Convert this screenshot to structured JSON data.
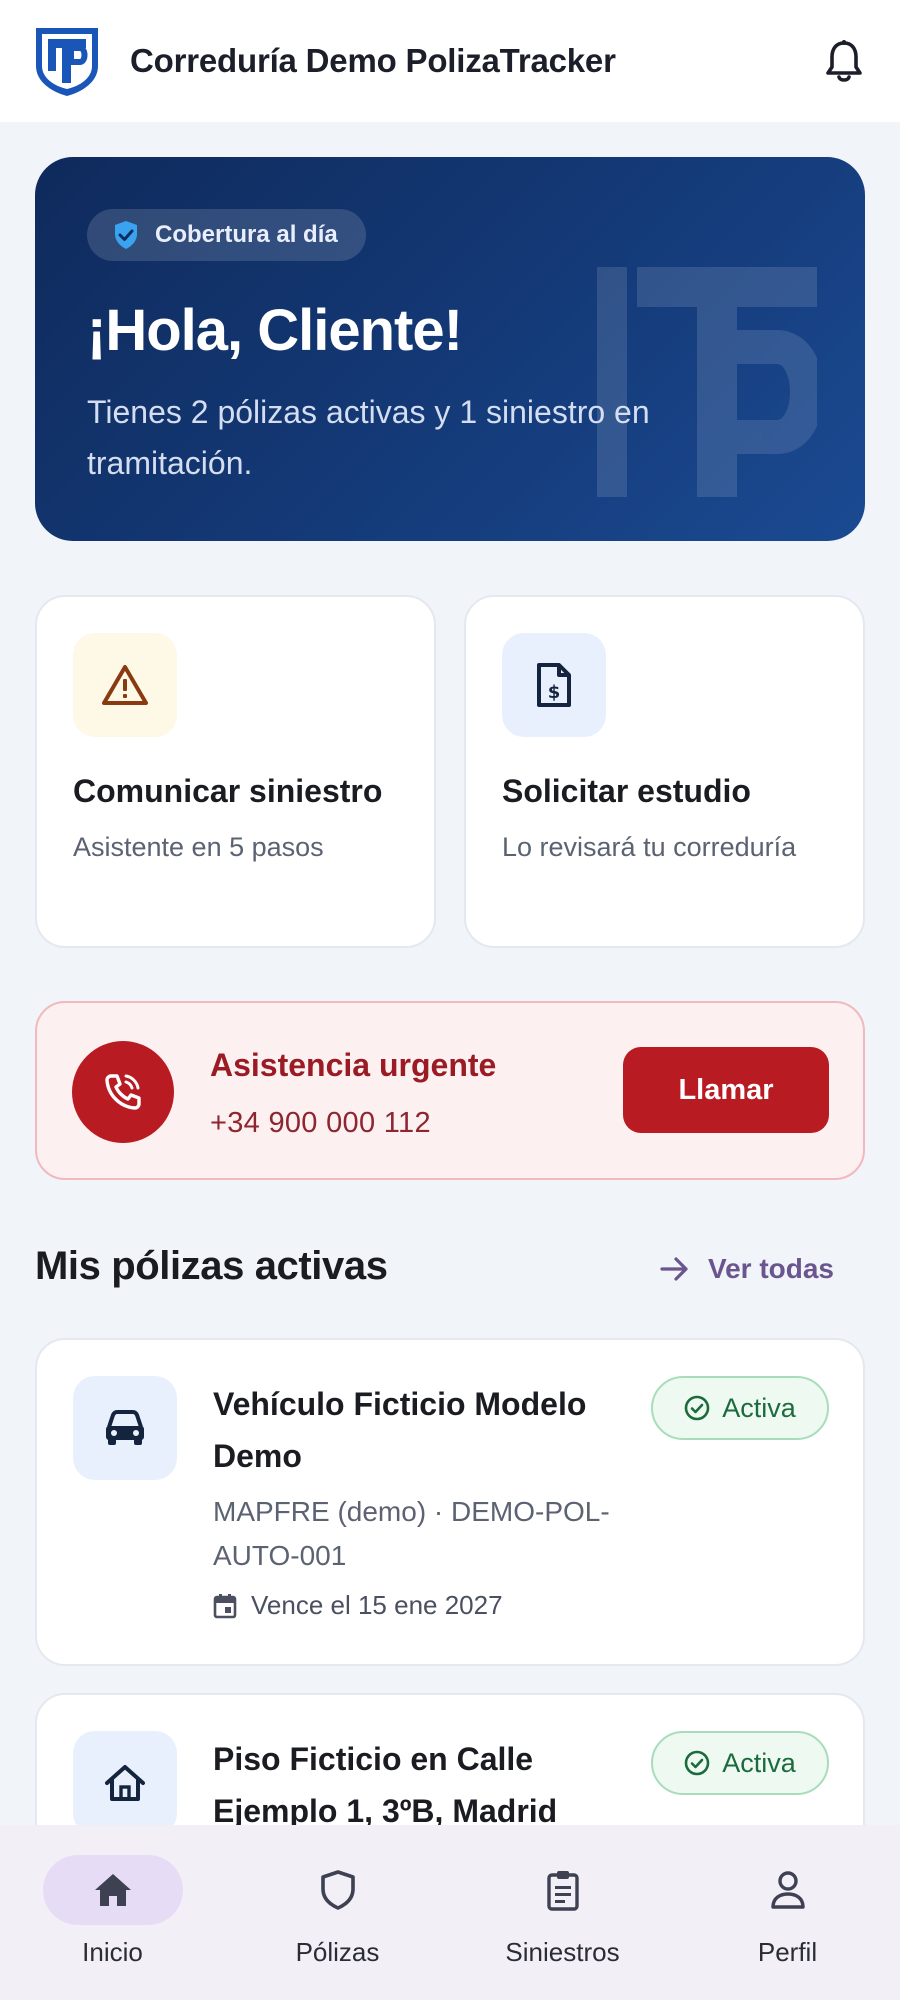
{
  "app": {
    "title": "Correduría Demo PolizaTracker"
  },
  "hero": {
    "chip": "Cobertura al día",
    "greeting": "¡Hola, Cliente!",
    "subtitle": "Tienes 2 pólizas activas y 1 siniestro en tramitación."
  },
  "actions": [
    {
      "title": "Comunicar siniestro",
      "subtitle": "Asistente en 5 pasos",
      "icon": "warning-triangle-icon"
    },
    {
      "title": "Solicitar estudio",
      "subtitle": "Lo revisará tu correduría",
      "icon": "invoice-document-icon"
    }
  ],
  "urgent": {
    "title": "Asistencia urgente",
    "phone": "+34 900 000 112",
    "button": "Llamar"
  },
  "policies_section": {
    "title": "Mis pólizas activas",
    "see_all": "Ver todas"
  },
  "policies": [
    {
      "name": "Vehículo Ficticio Modelo Demo",
      "meta": "MAPFRE (demo) · DEMO-POL-AUTO-001",
      "expiry": "Vence el 15 ene 2027",
      "status": "Activa",
      "icon": "car-icon"
    },
    {
      "name": "Piso Ficticio en Calle Ejemplo 1, 3ºB, Madrid",
      "status": "Activa",
      "icon": "home-icon"
    }
  ],
  "nav": [
    {
      "label": "Inicio",
      "icon": "home-icon"
    },
    {
      "label": "Pólizas",
      "icon": "shield-icon"
    },
    {
      "label": "Siniestros",
      "icon": "clipboard-icon"
    },
    {
      "label": "Perfil",
      "icon": "person-icon"
    }
  ],
  "colors": {
    "primary": "#143a78",
    "danger": "#b81c22",
    "success": "#1c6b3c",
    "accent": "#6a558f",
    "background": "#f1f4f9"
  }
}
